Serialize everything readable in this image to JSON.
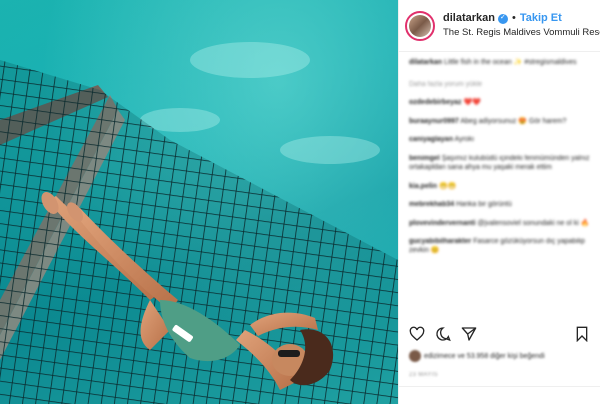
{
  "header": {
    "username": "dilatarkan",
    "separator": "•",
    "follow_label": "Takip Et",
    "location": "The St. Regis Maldives Vommuli Resort"
  },
  "caption": {
    "username": "dilatarkan",
    "text": "Little fish in the ocean ✨ #stregismaldives"
  },
  "load_more_label": "Daha fazla yorum yükle",
  "comments": [
    {
      "user": "ozdedebirbeyaz",
      "text": "❤️❤️"
    },
    {
      "user": "buraaynur0997",
      "text": "Abeg adiyorsunuz 😍 Gör harem?"
    },
    {
      "user": "caniyaglayan",
      "text": "Ayrokı"
    },
    {
      "user": "benimgel",
      "text": "Şaşımız kulubüdü içindeki fenmümünden yalnız ortakapldan sana ahya mu yaşaki merak ettim"
    },
    {
      "user": "kia.pelin",
      "text": "😁😁"
    },
    {
      "user": "mebrekhab34",
      "text": "Harika bir görüntü"
    },
    {
      "user": "plovevindervernanti",
      "text": "@jvalensoviel sonundaki ne ol ki 🔥"
    },
    {
      "user": "gucyabibilharakter",
      "text": "Fasarce gözüküyorsun dıç yapabilip zevkin 😊"
    }
  ],
  "actions": {
    "like_icon": "heart-icon",
    "comment_icon": "comment-icon",
    "share_icon": "share-icon",
    "save_icon": "bookmark-icon"
  },
  "likes_text": "edizimece ve 53.958 diğer kişi beğendi",
  "date": "23 MAYIS"
}
